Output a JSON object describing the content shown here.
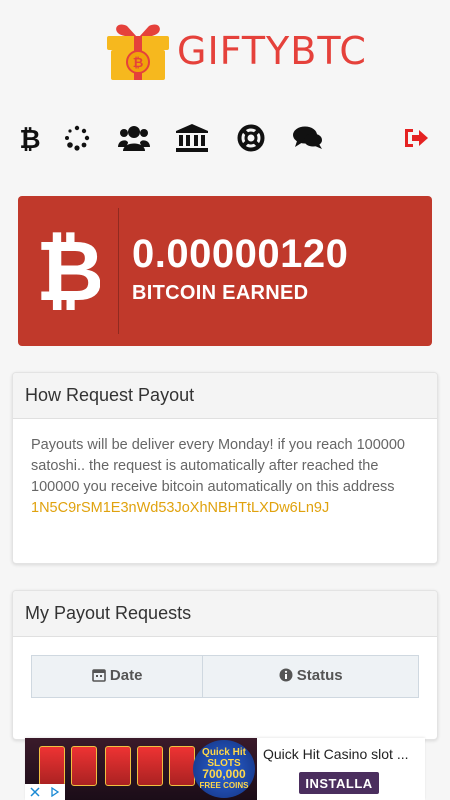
{
  "brand": {
    "name": "GIFTYBTC",
    "accent": "#e5413b"
  },
  "nav": {
    "items": [
      {
        "icon": "bitcoin-icon"
      },
      {
        "icon": "spinner-icon"
      },
      {
        "icon": "users-icon"
      },
      {
        "icon": "bank-icon"
      },
      {
        "icon": "lifebuoy-icon"
      },
      {
        "icon": "chat-icon"
      },
      {
        "icon": "logout-icon",
        "color": "#e52222"
      }
    ]
  },
  "earned": {
    "amount": "0.00000120",
    "label": "BITCOIN EARNED",
    "background": "#c0392b"
  },
  "payout_info": {
    "title": "How Request Payout",
    "text": "Payouts will be deliver every Monday! if you reach 100000 satoshi.. the request is automatically after reached the 100000 you receive bitcoin automatically on this address",
    "address": "1N5C9rSM1E3nWd53JoXhNBHTtLXDw6Ln9J",
    "address_color": "#e0a20e"
  },
  "payout_requests": {
    "title": "My Payout Requests",
    "columns": [
      "Date",
      "Status"
    ]
  },
  "ad": {
    "title": "Quick Hit Casino slot ...",
    "cta": "INSTALLA",
    "image_text_top": "Quick Hit",
    "image_text_mid": "SLOTS",
    "image_text_amount": "700,000",
    "image_text_bottom": "FREE COINS"
  }
}
